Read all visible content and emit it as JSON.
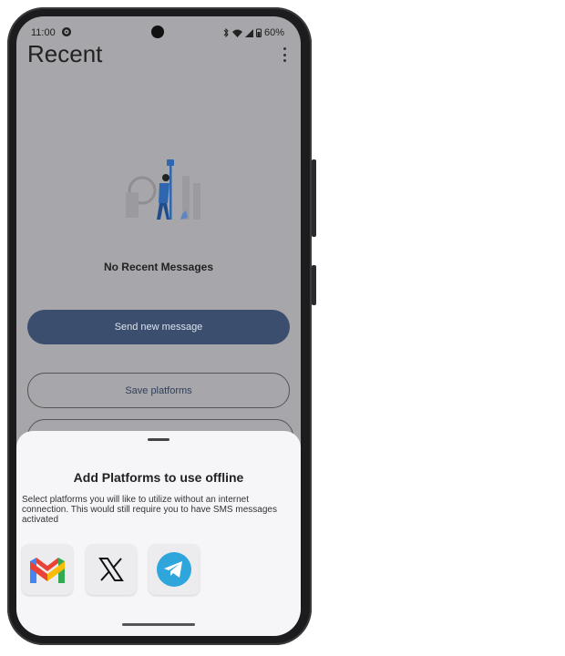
{
  "status_bar": {
    "time": "11:00",
    "battery": "60%"
  },
  "header": {
    "title": "Recent"
  },
  "empty_state": {
    "message": "No Recent Messages"
  },
  "actions": {
    "send_new_message": "Send new message",
    "save_platforms": "Save platforms"
  },
  "sheet": {
    "title": "Add Platforms to use offline",
    "description": "Select platforms you will like to utilize without an internet connection. This would still require you to have SMS messages activated",
    "platforms": [
      {
        "name": "gmail-icon"
      },
      {
        "name": "x-icon"
      },
      {
        "name": "telegram-icon"
      }
    ]
  },
  "colors": {
    "primary": "#3b4e6e",
    "sheet_bg": "#f6f6f9",
    "scrim_bg": "#a7a6aa",
    "telegram": "#2ea6dc"
  }
}
